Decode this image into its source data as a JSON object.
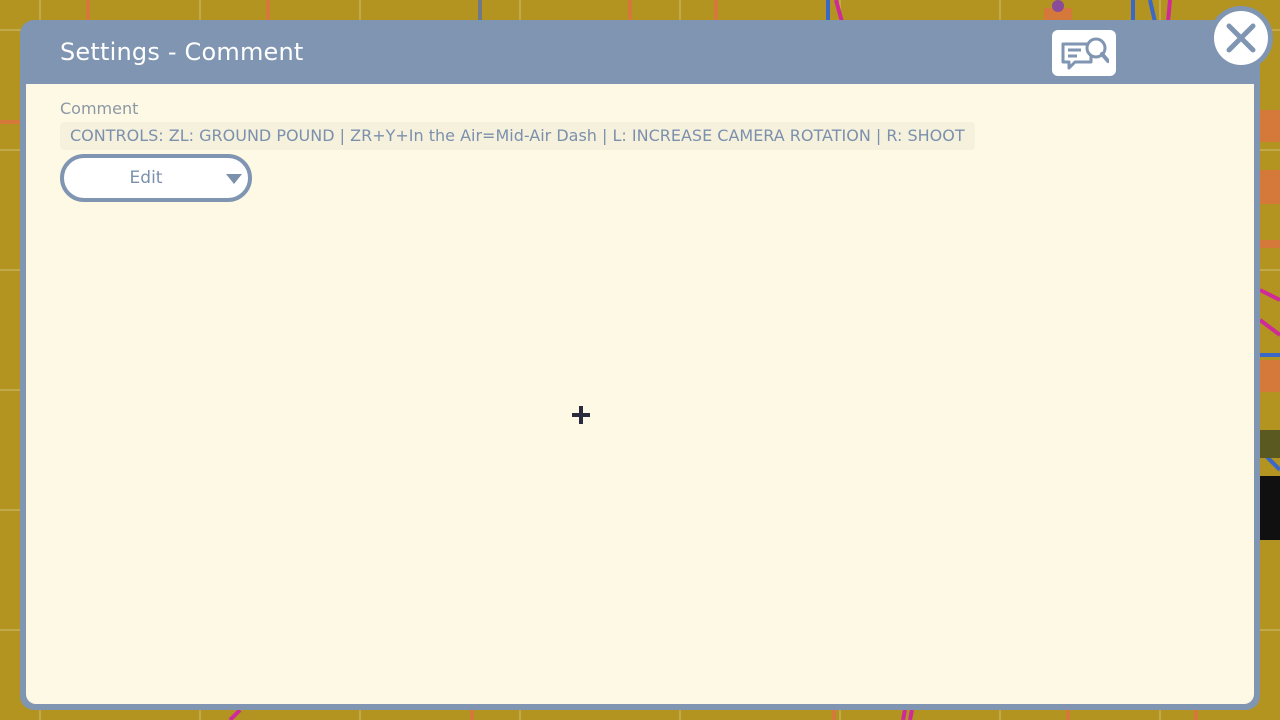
{
  "dialog": {
    "title": "Settings - Comment",
    "help_icon": "speech-bubble-search-icon",
    "close_icon": "close-x-icon"
  },
  "comment": {
    "label": "Comment",
    "value": "CONTROLS: ZL: GROUND POUND | ZR+Y+In the Air=Mid-Air Dash | L: INCREASE CAMERA ROTATION | R: SHOOT"
  },
  "edit_dropdown": {
    "selected": "Edit",
    "arrow_icon": "triangle-down-icon"
  },
  "cursor": {
    "icon": "plus-crosshair-icon"
  },
  "colors": {
    "background": "#b39420",
    "dialog_header": "#7f95b1",
    "content_bg": "#fef9e5",
    "text_muted": "#7b90ad",
    "white": "#ffffff"
  }
}
